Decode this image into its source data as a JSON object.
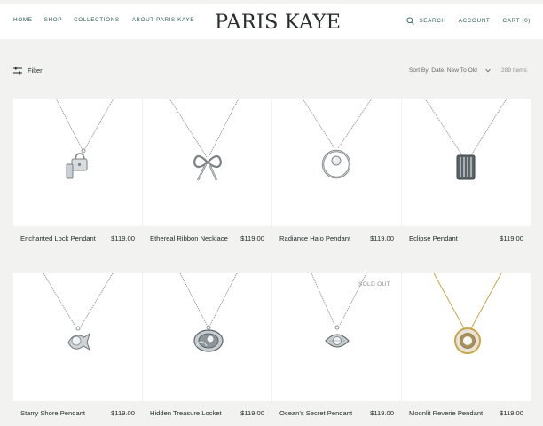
{
  "header": {
    "nav_left": [
      "HOME",
      "SHOP",
      "COLLECTIONS",
      "ABOUT PARIS KAYE"
    ],
    "logo": "PARIS KAYE",
    "search_label": "SEARCH",
    "account_label": "ACCOUNT",
    "cart_label": "CART (0)",
    "search_icon": "search-icon"
  },
  "toolbar": {
    "filter_label": "Filter",
    "filter_icon": "sliders-icon",
    "sort_label": "Sort By: Date, New To Old",
    "sort_icon": "chevron-down-icon",
    "item_count": "289 Items"
  },
  "products": [
    {
      "name": "Enchanted Lock Pendant",
      "price": "$119.00",
      "sold_out": ""
    },
    {
      "name": "Ethereal Ribbon Necklace",
      "price": "$119.00",
      "sold_out": ""
    },
    {
      "name": "Radiance Halo Pendant",
      "price": "$119.00",
      "sold_out": ""
    },
    {
      "name": "Eclipse Pendant",
      "price": "$119.00",
      "sold_out": ""
    },
    {
      "name": "Starry Shore Pendant",
      "price": "$119.00",
      "sold_out": ""
    },
    {
      "name": "Hidden Treasure Locket",
      "price": "$119.00",
      "sold_out": ""
    },
    {
      "name": "Ocean's Secret Pendant",
      "price": "$119.00",
      "sold_out": "SOLD OUT"
    },
    {
      "name": "Moonlit Reverie Pendant",
      "price": "$119.00",
      "sold_out": ""
    }
  ],
  "colors": {
    "page_bg": "#f2f3f1",
    "nav_accent": "#2e5d5a",
    "chain_silver": "#8e9497",
    "chain_gold": "#c9a64a"
  }
}
